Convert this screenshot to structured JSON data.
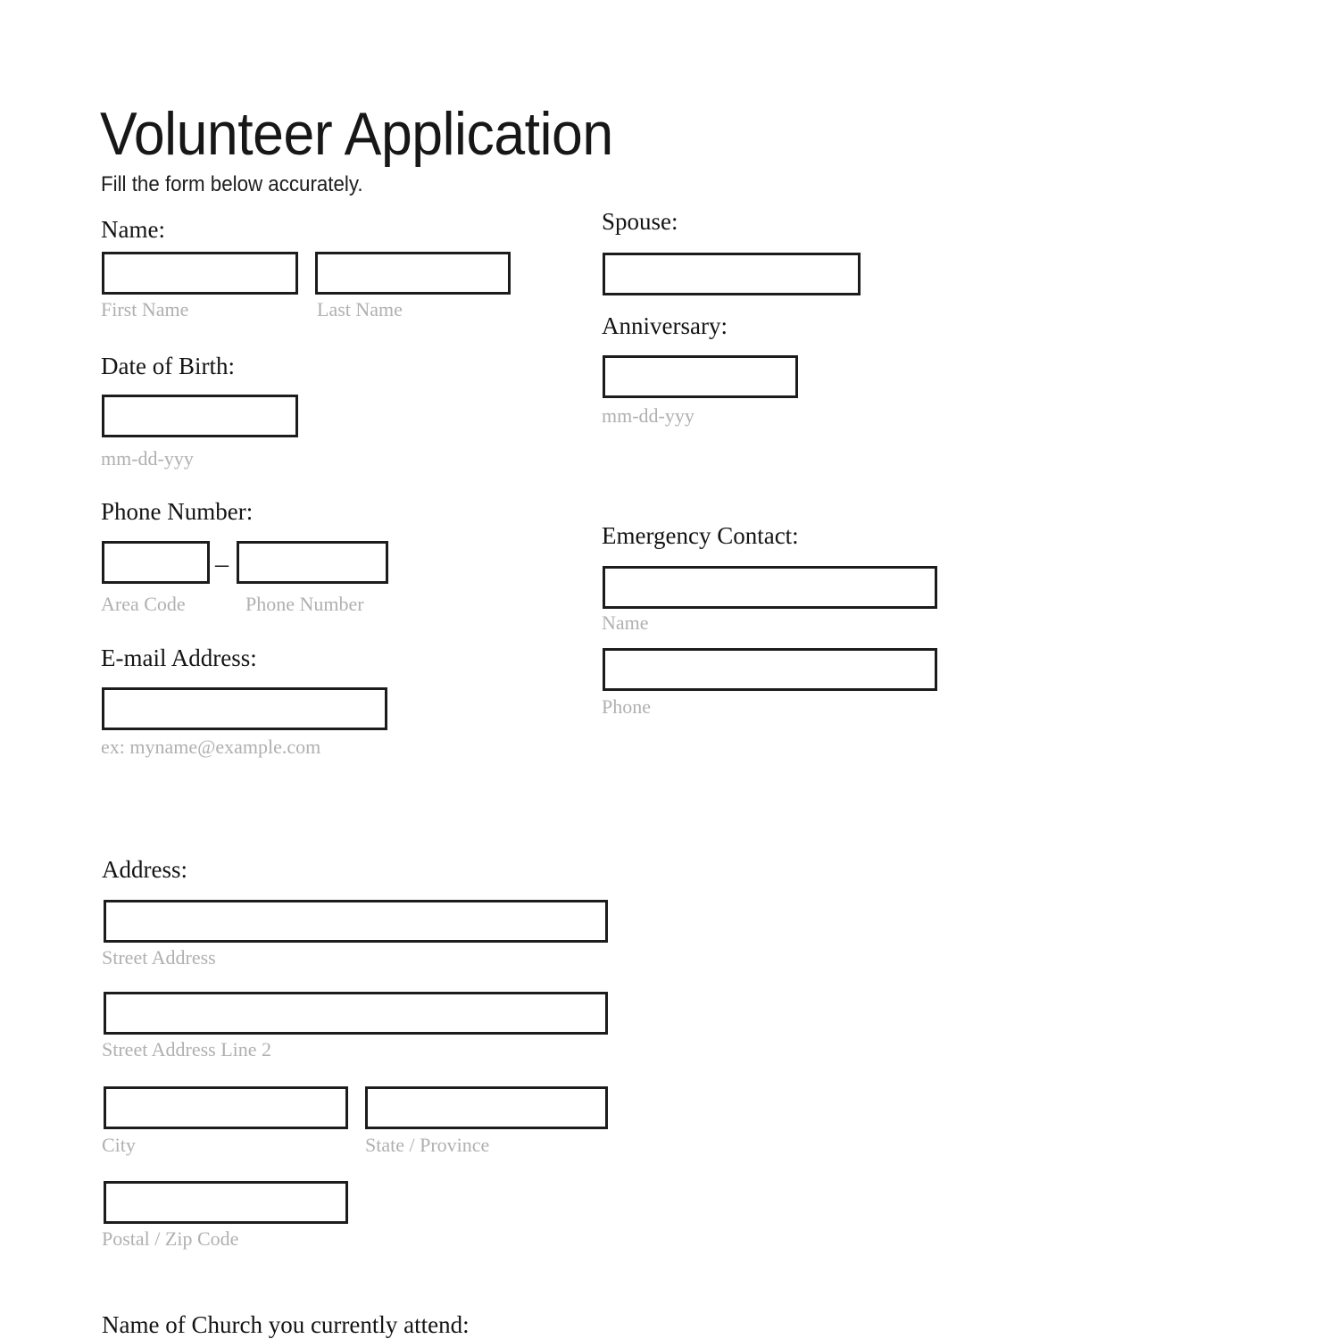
{
  "document": {
    "title": "Volunteer Application",
    "subtitle": "Fill the form below accurately."
  },
  "colors": {
    "text": "#141414",
    "hint": "#b0b0b0",
    "border": "#1c1c1c",
    "background": "#ffffff"
  },
  "fields": {
    "name": {
      "label": "Name:",
      "first_hint": "First Name",
      "first_value": "",
      "last_hint": "Last Name",
      "last_value": ""
    },
    "date_of_birth": {
      "label": "Date of Birth:",
      "hint": "mm-dd-yyy",
      "value": ""
    },
    "phone_number": {
      "label": "Phone Number:",
      "separator": "–",
      "area_code_hint": "Area Code",
      "area_code_value": "",
      "number_hint": "Phone Number",
      "number_value": ""
    },
    "email": {
      "label": "E-mail Address:",
      "hint": "ex: myname@example.com",
      "value": ""
    },
    "spouse": {
      "label": "Spouse:",
      "value": ""
    },
    "anniversary": {
      "label": "Anniversary:",
      "hint": "mm-dd-yyy",
      "value": ""
    },
    "emergency_contact": {
      "label": "Emergency Contact:",
      "name_hint": "Name",
      "name_value": "",
      "phone_hint": "Phone",
      "phone_value": ""
    },
    "address": {
      "label": "Address:",
      "street_hint": "Street Address",
      "street_value": "",
      "street2_hint": "Street Address Line 2",
      "street2_value": "",
      "city_hint": "City",
      "city_value": "",
      "state_hint": "State / Province",
      "state_value": "",
      "postal_hint": "Postal / Zip Code",
      "postal_value": ""
    },
    "church": {
      "label": "Name of Church you currently attend:"
    }
  }
}
